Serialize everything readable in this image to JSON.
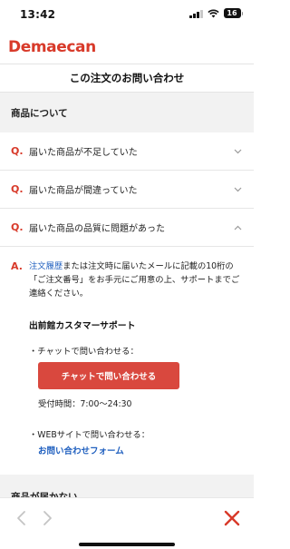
{
  "status": {
    "time": "13:42",
    "battery": "16"
  },
  "brand": {
    "name": "Demaecan"
  },
  "page": {
    "title": "この注文のお問い合わせ"
  },
  "sections": {
    "product_heading": "商品について",
    "not_delivered_heading": "商品が届かない"
  },
  "faq": [
    {
      "q": "Q.",
      "text": "届いた商品が不足していた",
      "expanded": false
    },
    {
      "q": "Q.",
      "text": "届いた商品が間違っていた",
      "expanded": false
    },
    {
      "q": "Q.",
      "text": "届いた商品の品質に問題があった",
      "expanded": true
    }
  ],
  "answer": {
    "mark": "A.",
    "link_text": "注文履歴",
    "text_after_link": "または注文時に届いたメールに記載の10桁の「ご注文番号」をお手元にご用意の上、サポートまでご連絡ください。",
    "support_title": "出前館カスタマーサポート",
    "chat_line": "・チャットで問い合わせる：",
    "chat_button": "チャットで問い合わせる",
    "hours": "受付時間：7:00〜24:30",
    "web_line": "・WEBサイトで問い合わせる：",
    "web_link": "お問い合わせフォーム"
  },
  "colors": {
    "brand": "#d83a2a",
    "link": "#1f5fbf",
    "button": "#d9483e"
  },
  "icons": {
    "back": "chevron-left-icon",
    "forward": "chevron-right-icon",
    "close": "close-icon",
    "collapsed": "chevron-down-icon",
    "expanded": "chevron-up-icon"
  }
}
